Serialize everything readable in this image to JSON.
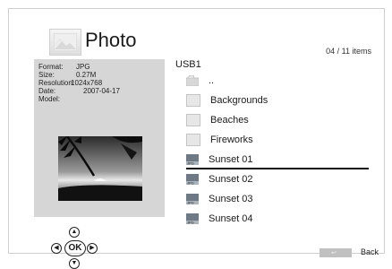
{
  "header": {
    "title": "Photo",
    "icon": "photo-icon"
  },
  "count": "04 / 11 items",
  "info": {
    "format_label": "Format:",
    "format_value": "JPG",
    "size_label": "Size:",
    "size_value": "0.27M",
    "resolution_label": "Resolution:",
    "resolution_value": "1024x768",
    "date_label": "Date:",
    "date_value": "2007-04-17",
    "model_label": "Model:",
    "model_value": ""
  },
  "breadcrumb": "USB1",
  "files": [
    {
      "label": "..",
      "icon": "parent-folder-icon"
    },
    {
      "label": "Backgrounds",
      "icon": "folder-icon"
    },
    {
      "label": "Beaches",
      "icon": "folder-icon"
    },
    {
      "label": "Fireworks",
      "icon": "folder-icon"
    },
    {
      "label": "Sunset 01",
      "icon": "jpg-file-icon",
      "selected": true
    },
    {
      "label": "Sunset 02",
      "icon": "jpg-file-icon"
    },
    {
      "label": "Sunset 03",
      "icon": "jpg-file-icon"
    },
    {
      "label": "Sunset 04",
      "icon": "jpg-file-icon"
    }
  ],
  "nav": {
    "ok_label": "OK"
  },
  "footer": {
    "back_label": "Back"
  }
}
